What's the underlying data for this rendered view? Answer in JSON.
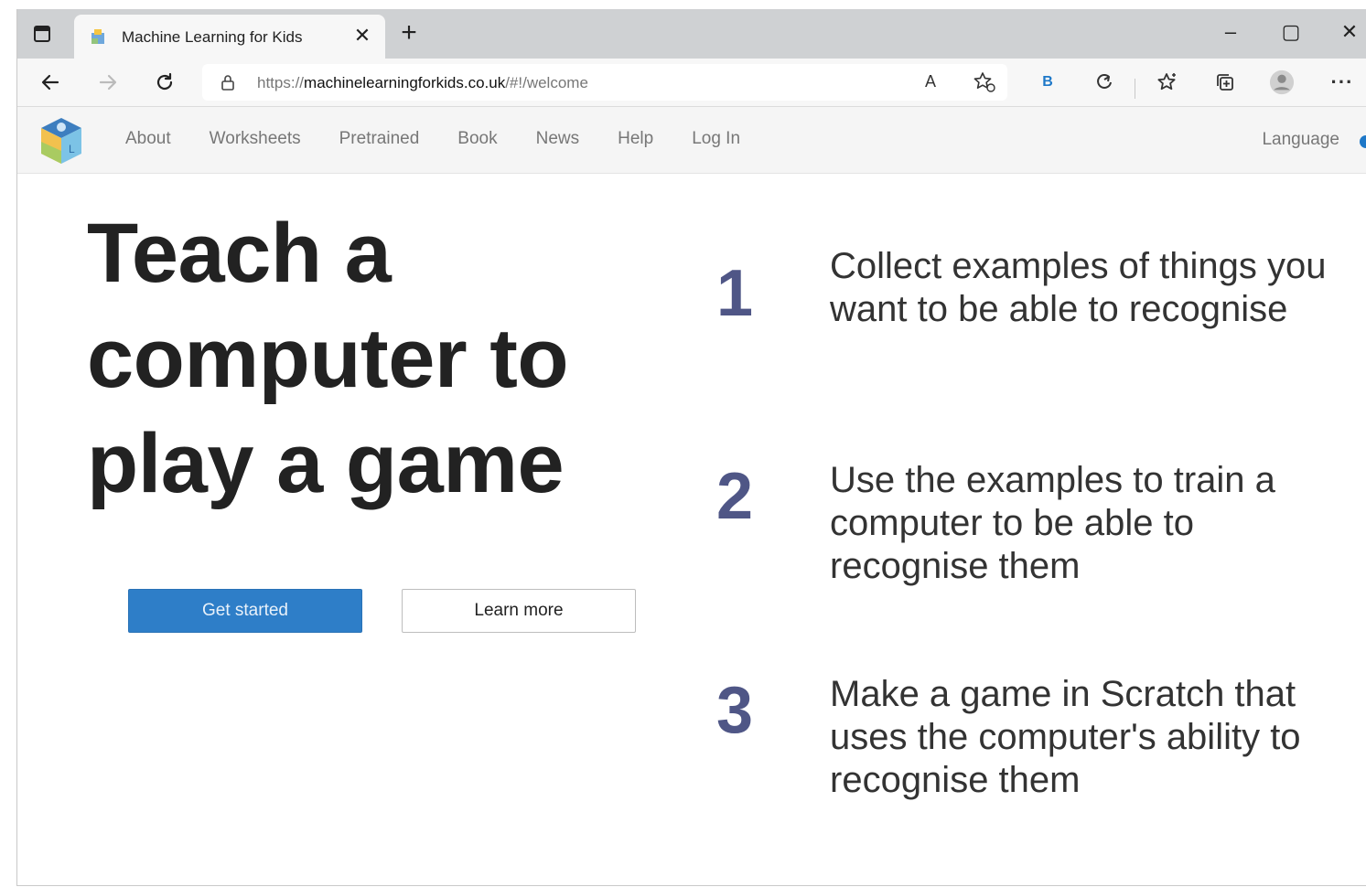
{
  "browser": {
    "tab": {
      "title": "Machine Learning for Kids",
      "close_glyph": "✕"
    },
    "new_tab_glyph": "+",
    "window_controls": {
      "minimize": "–",
      "maximize": "▢",
      "close": "✕"
    },
    "address": {
      "scheme": "https://",
      "host": "machinelearningforkids.co.uk",
      "path": "/#!/welcome"
    },
    "read_aloud_glyph": "A",
    "bing_label": "B",
    "more_glyph": "···",
    "icons": [
      "tab-actions-icon",
      "back-icon",
      "forward-icon",
      "refresh-icon",
      "lock-icon",
      "read-aloud-icon",
      "add-favorite-icon",
      "bing-icon",
      "extensions-icon",
      "favorites-icon",
      "collections-icon",
      "profile-icon",
      "more-icon"
    ]
  },
  "site_nav": {
    "links": [
      "About",
      "Worksheets",
      "Pretrained",
      "Book",
      "News",
      "Help",
      "Log In"
    ],
    "language": "Language",
    "accent": "#1e78c8"
  },
  "hero": {
    "title_lines": [
      "Teach a",
      "computer to",
      "play a game"
    ],
    "get_started": "Get started",
    "learn_more": "Learn more",
    "primary_color": "#2e7ec8"
  },
  "steps": [
    {
      "number": "1",
      "text": "Collect examples of things you want to be able to recognise"
    },
    {
      "number": "2",
      "text": "Use the examples to train a computer to be able to recognise them"
    },
    {
      "number": "3",
      "text": "Make a game in Scratch that uses the computer's ability to recognise them"
    }
  ],
  "colors": {
    "step_number": "#4f5686",
    "tab_strip": "#cfd1d3"
  }
}
